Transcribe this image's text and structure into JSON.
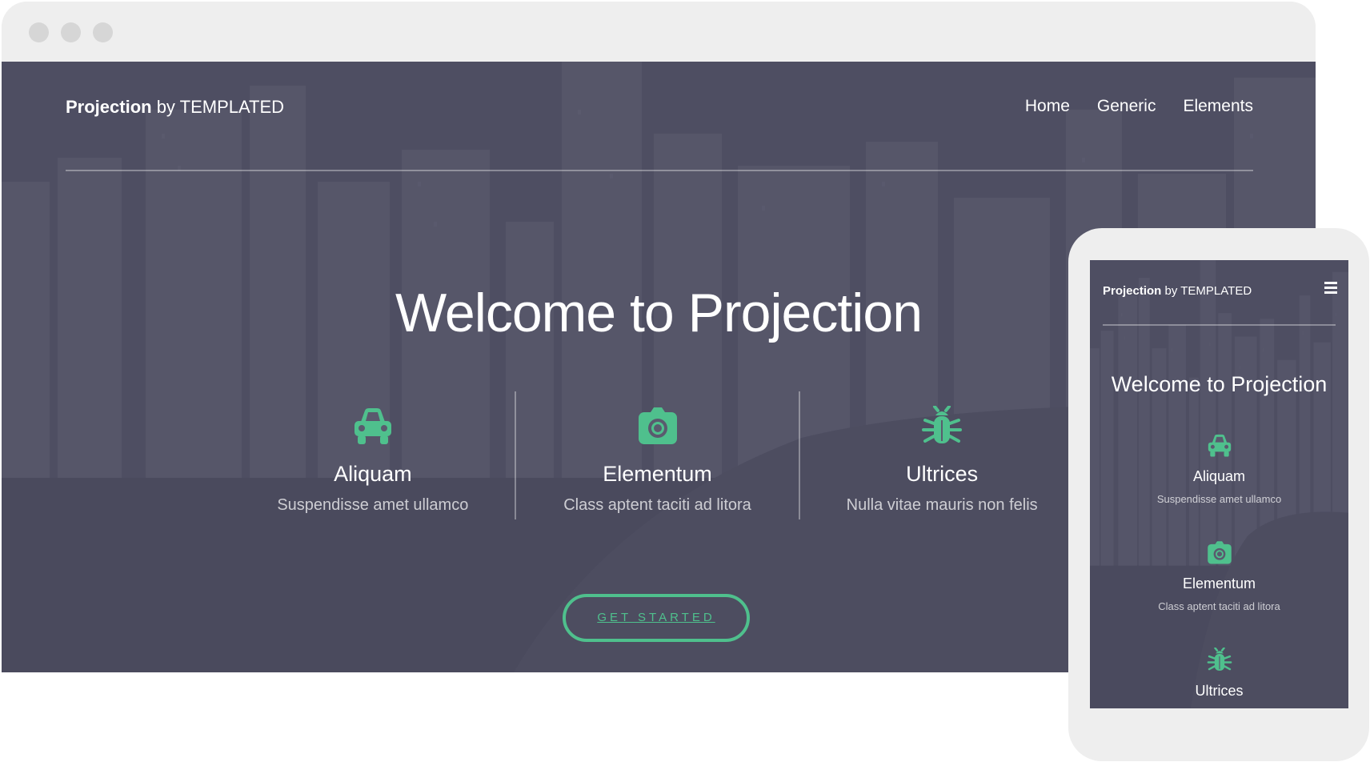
{
  "site": {
    "brand_bold": "Projection",
    "brand_rest": " by TEMPLATED",
    "nav": [
      "Home",
      "Generic",
      "Elements"
    ],
    "hero_title": "Welcome to Projection",
    "features": [
      {
        "icon": "car-icon",
        "title": "Aliquam",
        "subtitle": "Suspendisse amet ullamco"
      },
      {
        "icon": "camera-icon",
        "title": "Elementum",
        "subtitle": "Class aptent taciti ad litora"
      },
      {
        "icon": "bug-icon",
        "title": "Ultrices",
        "subtitle": "Nulla vitae mauris non felis"
      }
    ],
    "cta_label": "GET STARTED"
  },
  "mobile": {
    "brand_bold": "Projection",
    "brand_rest": " by TEMPLATED",
    "menu_icon": "hamburger-icon",
    "hero_title": "Welcome to Projection",
    "features": [
      {
        "icon": "car-icon",
        "title": "Aliquam",
        "subtitle": "Suspendisse amet ullamco"
      },
      {
        "icon": "camera-icon",
        "title": "Elementum",
        "subtitle": "Class aptent taciti ad litora"
      },
      {
        "icon": "bug-icon",
        "title": "Ultrices"
      }
    ]
  },
  "colors": {
    "accent": "#4fc08d",
    "overlay": "#505064",
    "frame": "#eeeeee"
  }
}
